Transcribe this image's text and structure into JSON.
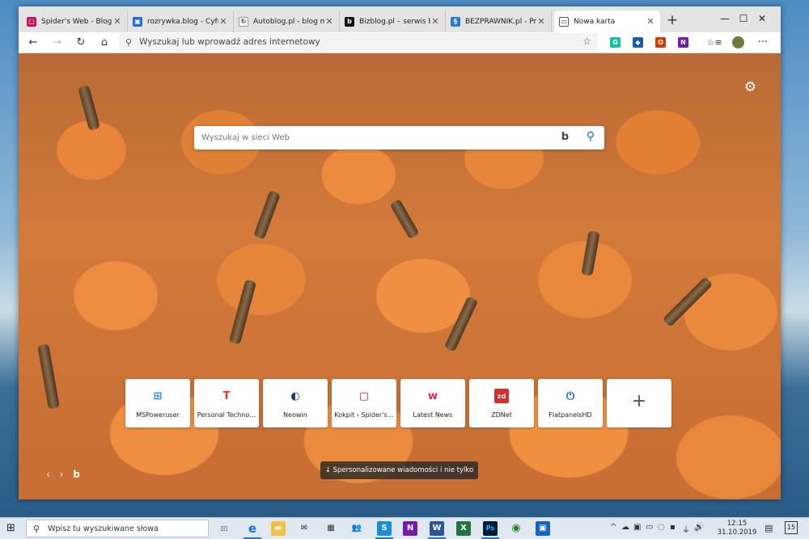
{
  "browser": {
    "tabs": [
      {
        "title": "Spider's Web - Blog Blisk",
        "favicon": "spidersweb-icon",
        "color": "#c4145d",
        "glyph": "▢"
      },
      {
        "title": "rozrywka.blog - Cyfrowy",
        "favicon": "rozrywka-icon",
        "color": "#1e6fd8",
        "glyph": "▣"
      },
      {
        "title": "Autoblog.pl - blog motor",
        "favicon": "autoblog-icon",
        "color": "#ffffff",
        "glyph": "↻"
      },
      {
        "title": "Bizblog.pl – serwis bizne",
        "favicon": "bizblog-icon",
        "color": "#111111",
        "glyph": "b"
      },
      {
        "title": "BEZPRAWNIK.pl - Prawo",
        "favicon": "bezprawnik-icon",
        "color": "#2b7bd6",
        "glyph": "§"
      },
      {
        "title": "Nowa karta",
        "favicon": "newtab-icon",
        "color": "#ffffff",
        "glyph": "▭"
      }
    ],
    "new_tab": "+",
    "window_controls": {
      "minimize": "—",
      "maximize": "☐",
      "close": "✕"
    },
    "toolbar": {
      "back": "←",
      "forward": "→",
      "refresh": "↻",
      "home": "⌂",
      "address_placeholder": "Wyszukaj lub wprowadź adres internetowy",
      "favorite": "☆",
      "favorites_hub": "☆≡",
      "menu": "···"
    },
    "extensions": [
      {
        "name": "grammarly-icon",
        "color": "#15c39a",
        "glyph": "G"
      },
      {
        "name": "shopping-icon",
        "color": "#1b5ea8",
        "glyph": "◆"
      },
      {
        "name": "office-icon",
        "color": "#d83b01",
        "glyph": "O"
      },
      {
        "name": "onenote-icon",
        "color": "#7719aa",
        "glyph": "N"
      }
    ]
  },
  "newtab": {
    "settings": "⚙",
    "search_placeholder": "Wyszukaj w sieci Web",
    "bing_glyph": "b",
    "search_glyph": "⚲",
    "tiles": [
      {
        "name": "MSPoweruser",
        "icon": "windows-icon",
        "color": "#1e88e5",
        "glyph": "⊞"
      },
      {
        "name": "Personal Techno…",
        "icon": "colorful-t-icon",
        "color": "#e53935",
        "glyph": "T"
      },
      {
        "name": "Neowin",
        "icon": "neowin-icon",
        "color": "#1a3b6e",
        "glyph": "◐"
      },
      {
        "name": "Kokpit ‹ Spider's…",
        "icon": "spidersweb-icon",
        "color": "#c4145d",
        "glyph": "▢"
      },
      {
        "name": "Latest News",
        "icon": "latest-news-icon",
        "color": "#e91e63",
        "glyph": "w"
      },
      {
        "name": "ZDNet",
        "icon": "zdnet-icon",
        "color": "#d32f2f",
        "glyph": "zd"
      },
      {
        "name": "FlatpanelsHD",
        "icon": "power-icon",
        "color": "#1565c0",
        "glyph": "⏻"
      }
    ],
    "add_tile": "+",
    "carousel": {
      "prev": "‹",
      "next": "›",
      "bing": "b"
    },
    "news_button": "↓  Spersonalizowane wiadomości i nie tylko"
  },
  "taskbar": {
    "start": "⊞",
    "search_placeholder": "Wpisz tu wyszukiwane słowa",
    "apps": [
      {
        "name": "task-view-icon",
        "color": "#dfe7ef",
        "glyph": "▯▯",
        "text": "#333"
      },
      {
        "name": "edge-icon",
        "color": "#dfe7ef",
        "glyph": "e",
        "text": "#1e6fd8"
      },
      {
        "name": "file-explorer-icon",
        "color": "#f2c043",
        "glyph": "▬",
        "text": "#fff"
      },
      {
        "name": "mail-icon",
        "color": "#dfe7ef",
        "glyph": "✉",
        "text": "#333"
      },
      {
        "name": "calendar-icon",
        "color": "#dfe7ef",
        "glyph": "▦",
        "text": "#333"
      },
      {
        "name": "people-icon",
        "color": "#dfe7ef",
        "glyph": "👥",
        "text": "#333"
      },
      {
        "name": "skype-icon",
        "color": "#1b8fd6",
        "glyph": "S",
        "text": "#fff"
      },
      {
        "name": "onenote-icon",
        "color": "#7719aa",
        "glyph": "N",
        "text": "#fff"
      },
      {
        "name": "word-icon",
        "color": "#2b579a",
        "glyph": "W",
        "text": "#fff"
      },
      {
        "name": "excel-icon",
        "color": "#217346",
        "glyph": "X",
        "text": "#fff"
      },
      {
        "name": "photoshop-icon",
        "color": "#001e36",
        "glyph": "Ps",
        "text": "#31a8ff"
      },
      {
        "name": "chrome-icon",
        "color": "#dfe7ef",
        "glyph": "◉",
        "text": "#2e7d32"
      },
      {
        "name": "store-icon",
        "color": "#1565c0",
        "glyph": "▣",
        "text": "#fff"
      }
    ],
    "tray_icons": [
      "^",
      "☁",
      "▣",
      "▭",
      "◌",
      "▪",
      "⏚",
      "🔊"
    ],
    "time": "12:15",
    "date": "31.10.2019",
    "notifications": "15"
  }
}
